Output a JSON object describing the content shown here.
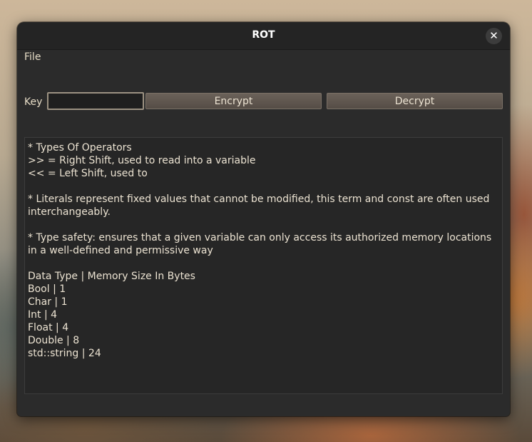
{
  "window": {
    "title": "ROT",
    "close_glyph": "✕"
  },
  "menu": {
    "file_label": "File"
  },
  "controls": {
    "key_label": "Key",
    "key_value": "",
    "encrypt_label": "Encrypt",
    "decrypt_label": "Decrypt"
  },
  "text": {
    "lines": [
      "* Types Of Operators",
      ">> = Right Shift, used to read into a variable",
      "<< = Left Shift, used to",
      "",
      "* Literals represent fixed values that cannot be modified, this term and const are often used interchangeably.",
      "",
      "* Type safety: ensures that a given variable can only access its authorized memory locations in a well-defined and permissive way",
      "",
      "Data Type | Memory Size In Bytes",
      "Bool | 1",
      "Char | 1",
      "Int | 4",
      "Float | 4",
      "Double | 8",
      "std::string | 24"
    ]
  },
  "icons": {
    "close": "close-icon"
  }
}
